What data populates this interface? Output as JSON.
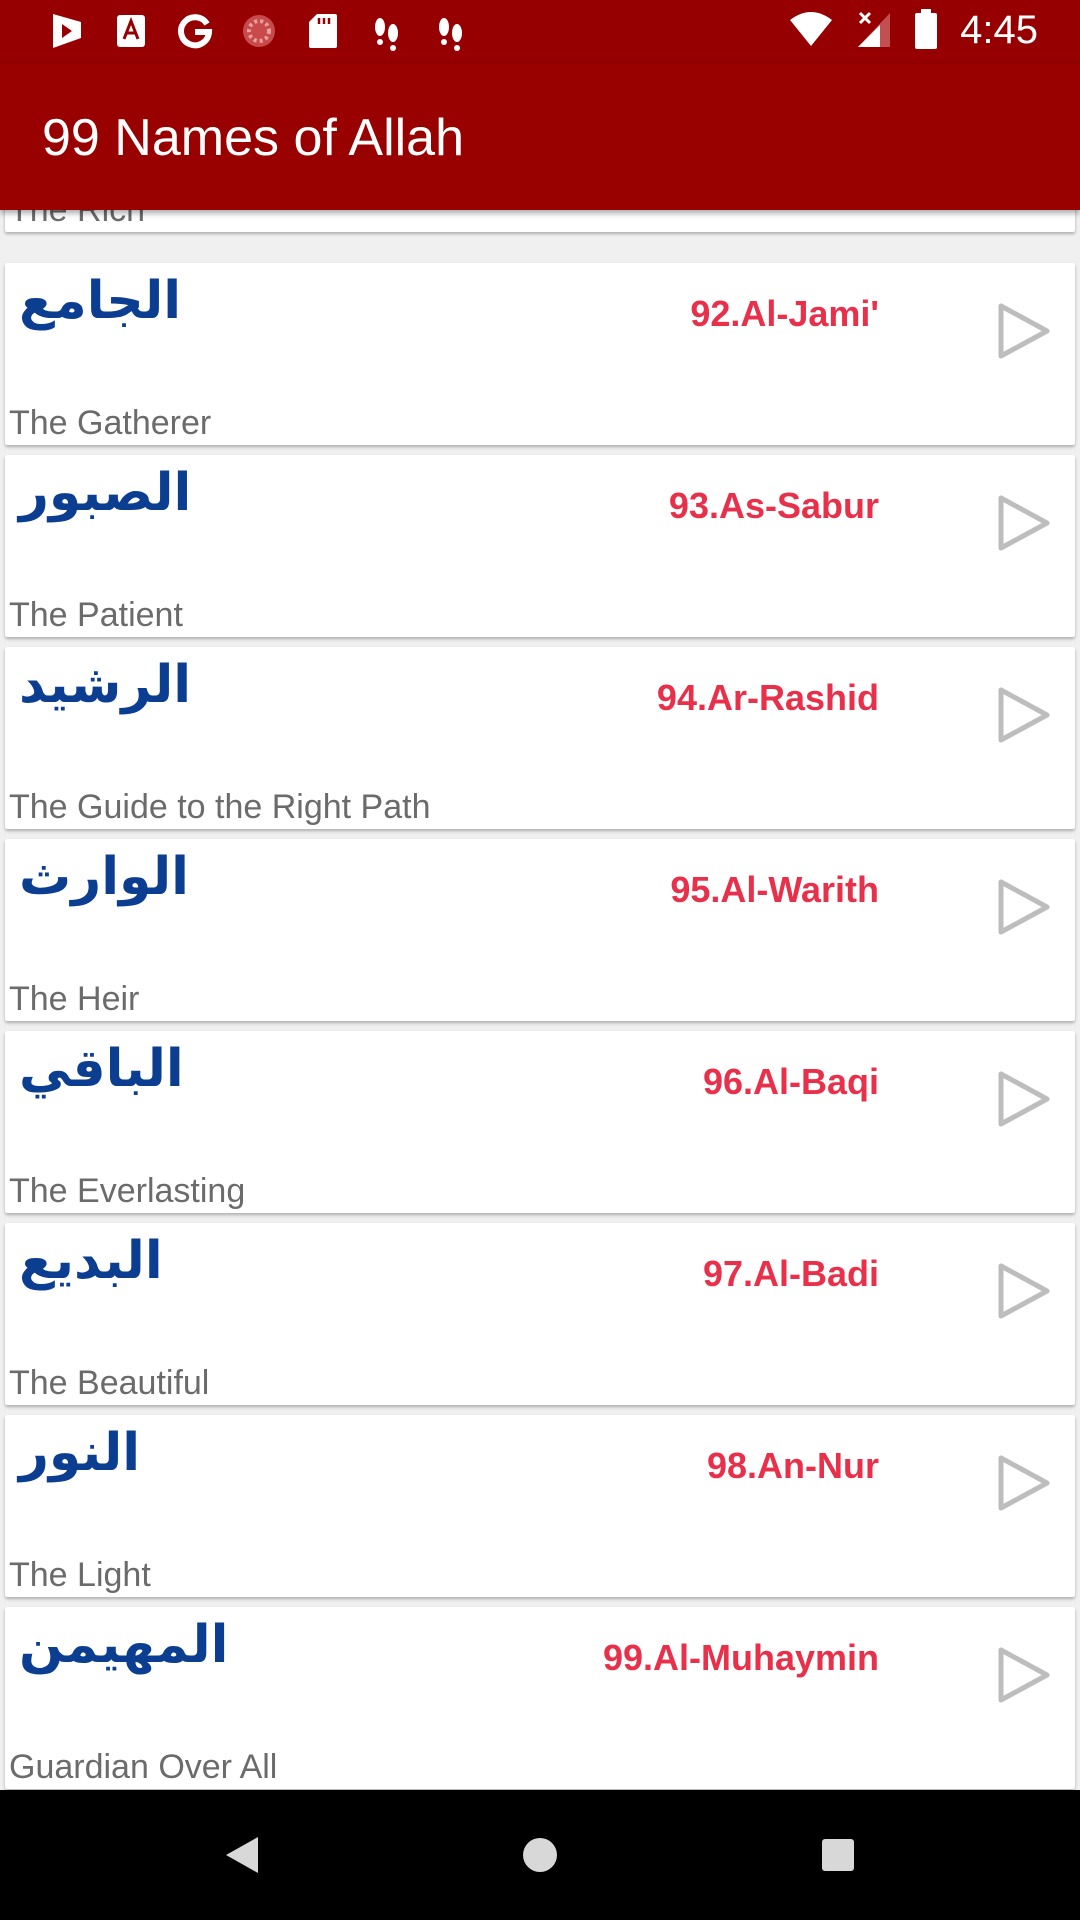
{
  "status_bar": {
    "time": "4:45",
    "left_icons": [
      "play-store-icon",
      "font-a-icon",
      "google-icon",
      "loading-icon",
      "sd-card-icon",
      "footprints-icon",
      "footprints-icon"
    ],
    "right_icons": [
      "wifi-icon",
      "no-signal-icon",
      "battery-icon"
    ]
  },
  "app_bar": {
    "title": "99 Names of Allah"
  },
  "colors": {
    "status_bar": "#960000",
    "app_bar": "#990000",
    "arabic": "#0b3d91",
    "transliteration": "#e8304a",
    "meaning": "#6b6b6b",
    "play_icon": "#bdbdbd"
  },
  "partial_item": {
    "meaning": "The Rich"
  },
  "names": [
    {
      "arabic": "الجامع",
      "transliteration": "92.Al-Jami'",
      "meaning": "The Gatherer"
    },
    {
      "arabic": "الصبور",
      "transliteration": "93.As-Sabur",
      "meaning": "The Patient"
    },
    {
      "arabic": "الرشيد",
      "transliteration": "94.Ar-Rashid",
      "meaning": "The Guide to the Right Path"
    },
    {
      "arabic": "الوارث",
      "transliteration": "95.Al-Warith",
      "meaning": "The Heir"
    },
    {
      "arabic": "الباقي",
      "transliteration": "96.Al-Baqi",
      "meaning": "The Everlasting"
    },
    {
      "arabic": "البديع",
      "transliteration": "97.Al-Badi",
      "meaning": "The Beautiful"
    },
    {
      "arabic": "النور",
      "transliteration": "98.An-Nur",
      "meaning": "The Light"
    },
    {
      "arabic": "المهيمن",
      "transliteration": "99.Al-Muhaymin",
      "meaning": "Guardian Over All"
    }
  ],
  "nav_bar": {
    "icons": [
      "back-icon",
      "home-icon",
      "recents-icon"
    ]
  }
}
